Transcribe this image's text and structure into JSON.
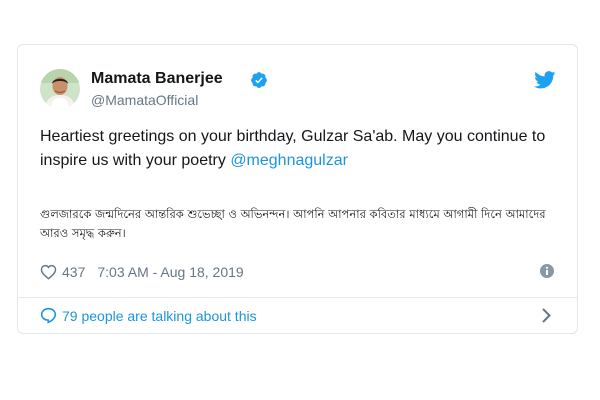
{
  "tweet": {
    "author_name": "Mamata Banerjee",
    "handle": "@MamataOfficial",
    "text": "Heartiest greetings on your birthday, Gulzar Sa'ab. May you continue to inspire us with your poetry ",
    "mention": "@meghnagulzar",
    "bengali_text": "গুলজারকে জন্মদিনের আন্তরিক শুভেচ্ছা ও অভিনন্দন। আপনি আপনার কবিতার মাধ্যমে আগামী দিনে আমাদের আরও সমৃদ্ধ করুন।",
    "likes": "437",
    "timestamp": "7:03 AM - Aug 18, 2019",
    "conversation": "79 people are talking about this"
  },
  "icons": {
    "verified": "verified-badge-icon",
    "platform": "twitter-bird-icon",
    "like": "heart-icon",
    "info": "info-icon",
    "reply": "speech-bubble-icon",
    "more": "chevron-right-icon"
  },
  "colors": {
    "link": "#1b95e0",
    "secondary_text": "#657786",
    "border": "#e1e8ed"
  }
}
